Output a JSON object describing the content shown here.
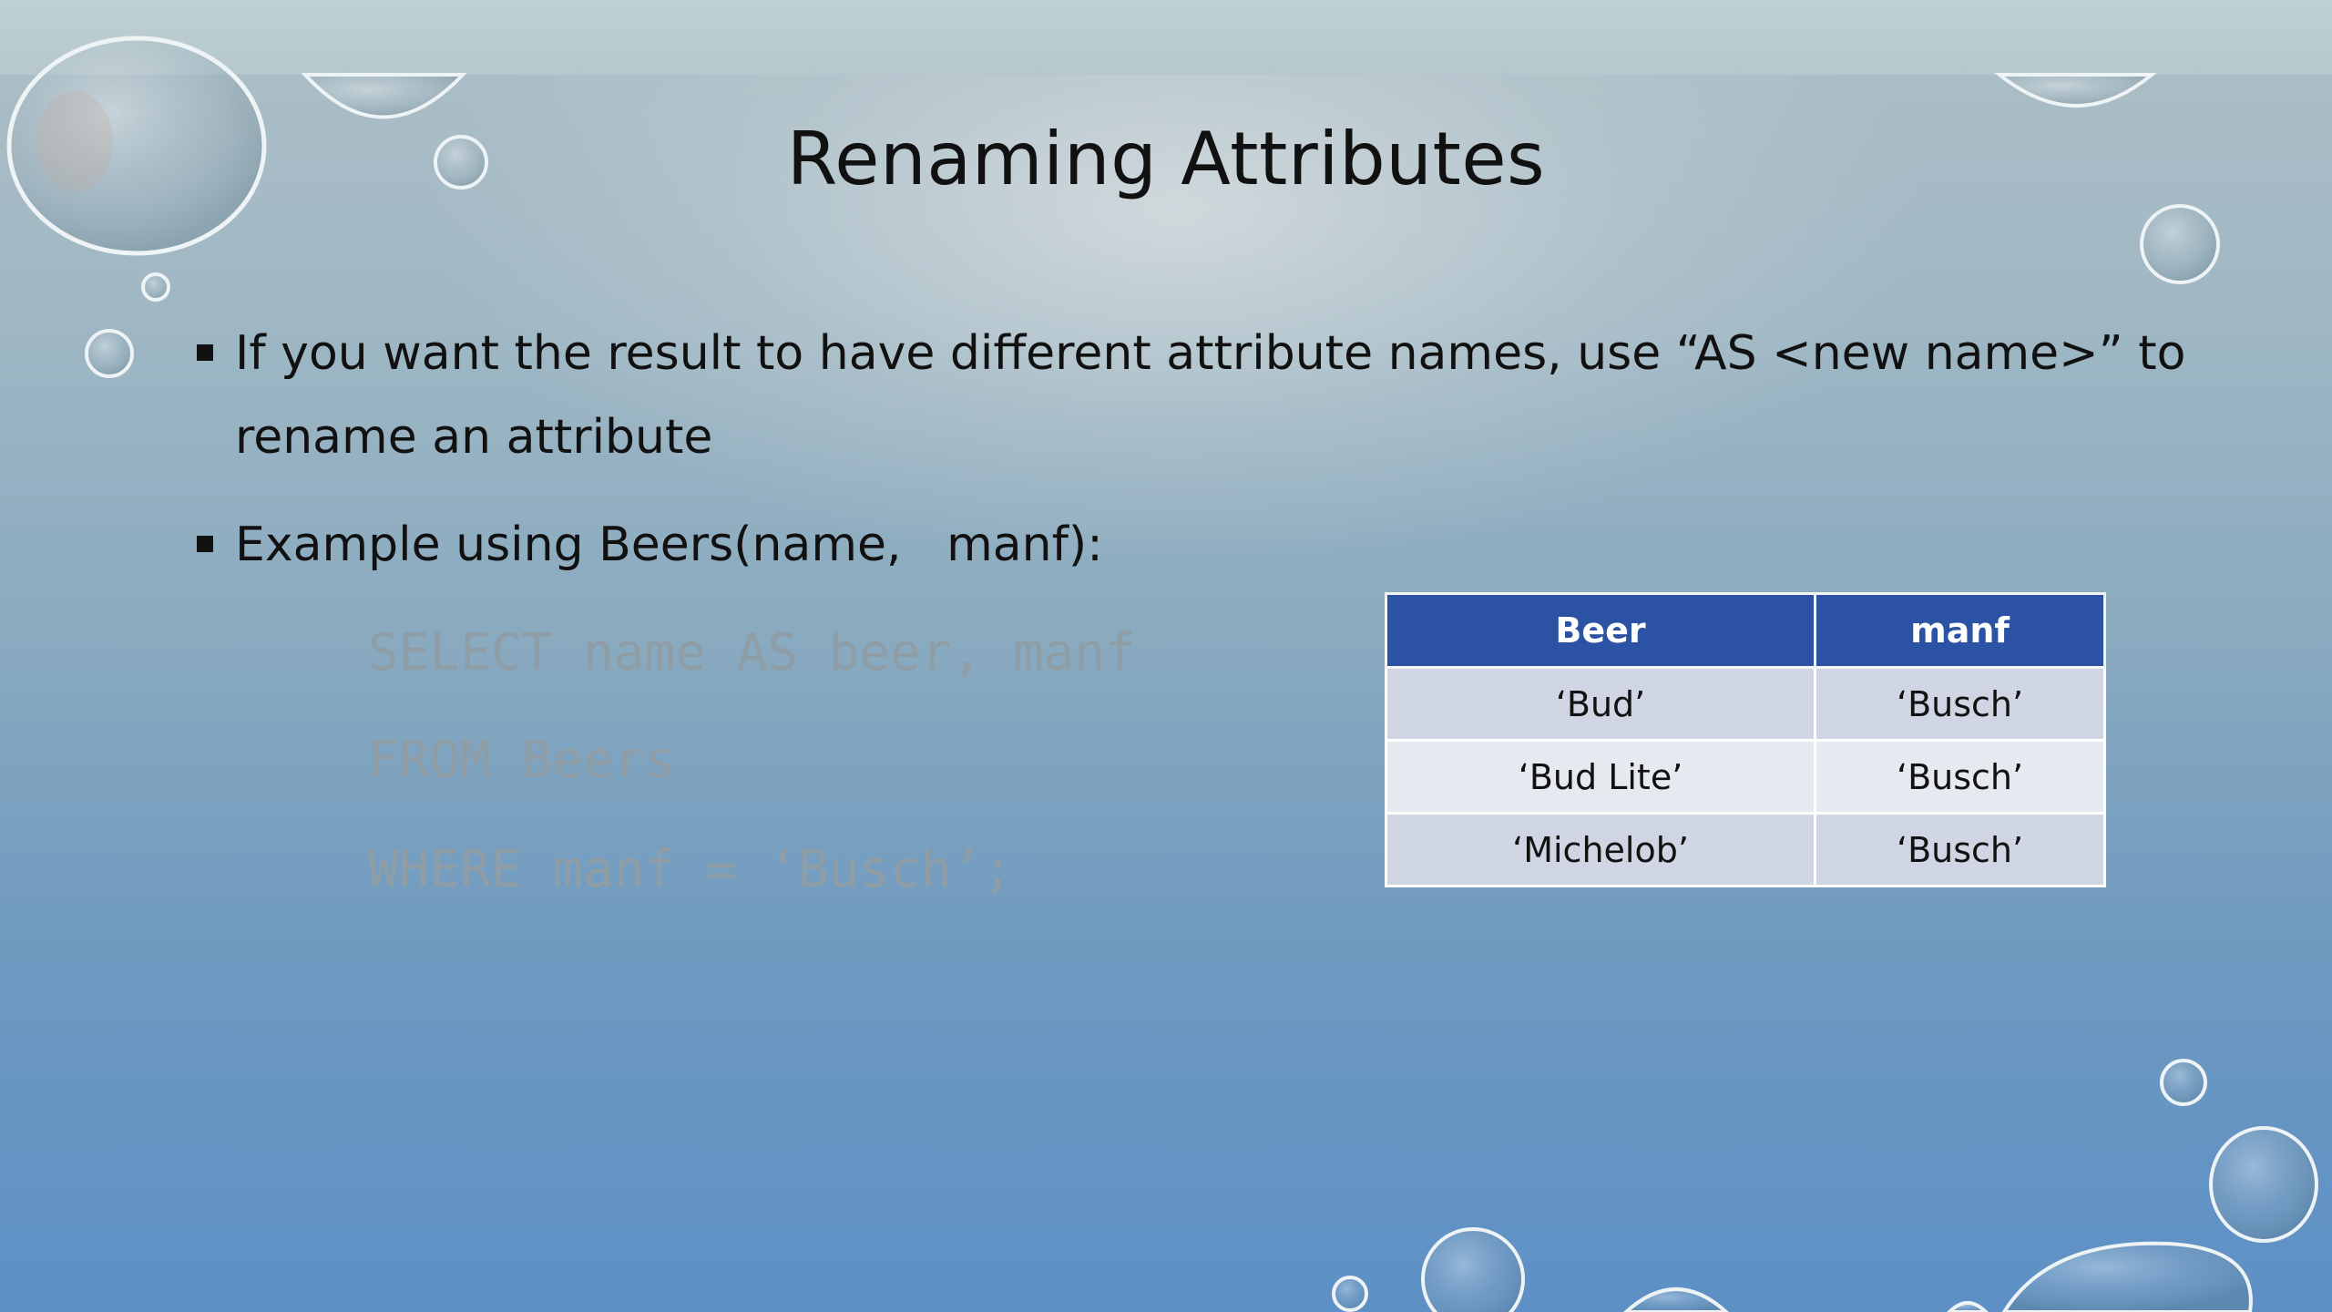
{
  "slide": {
    "title": "Renaming Attributes",
    "bullets": [
      {
        "line1": "If you want the result to have different attribute names, use “AS <new name>” to",
        "line2": "rename an attribute"
      },
      {
        "line1": "Example using Beers(name,   manf):"
      }
    ],
    "code": [
      "SELECT name AS beer, manf",
      "FROM Beers",
      "WHERE manf = ‘Busch’;"
    ],
    "table": {
      "headers": [
        "Beer",
        "manf"
      ],
      "rows": [
        [
          "‘Bud’",
          "‘Busch’"
        ],
        [
          "‘Bud Lite’",
          "‘Busch’"
        ],
        [
          "‘Michelob’",
          "‘Busch’"
        ]
      ]
    }
  },
  "colors": {
    "table_header": "#2c52a3",
    "row_odd": "#cfd5e2",
    "row_even": "#e6e9ef",
    "code_text": "#8f9ea6"
  }
}
